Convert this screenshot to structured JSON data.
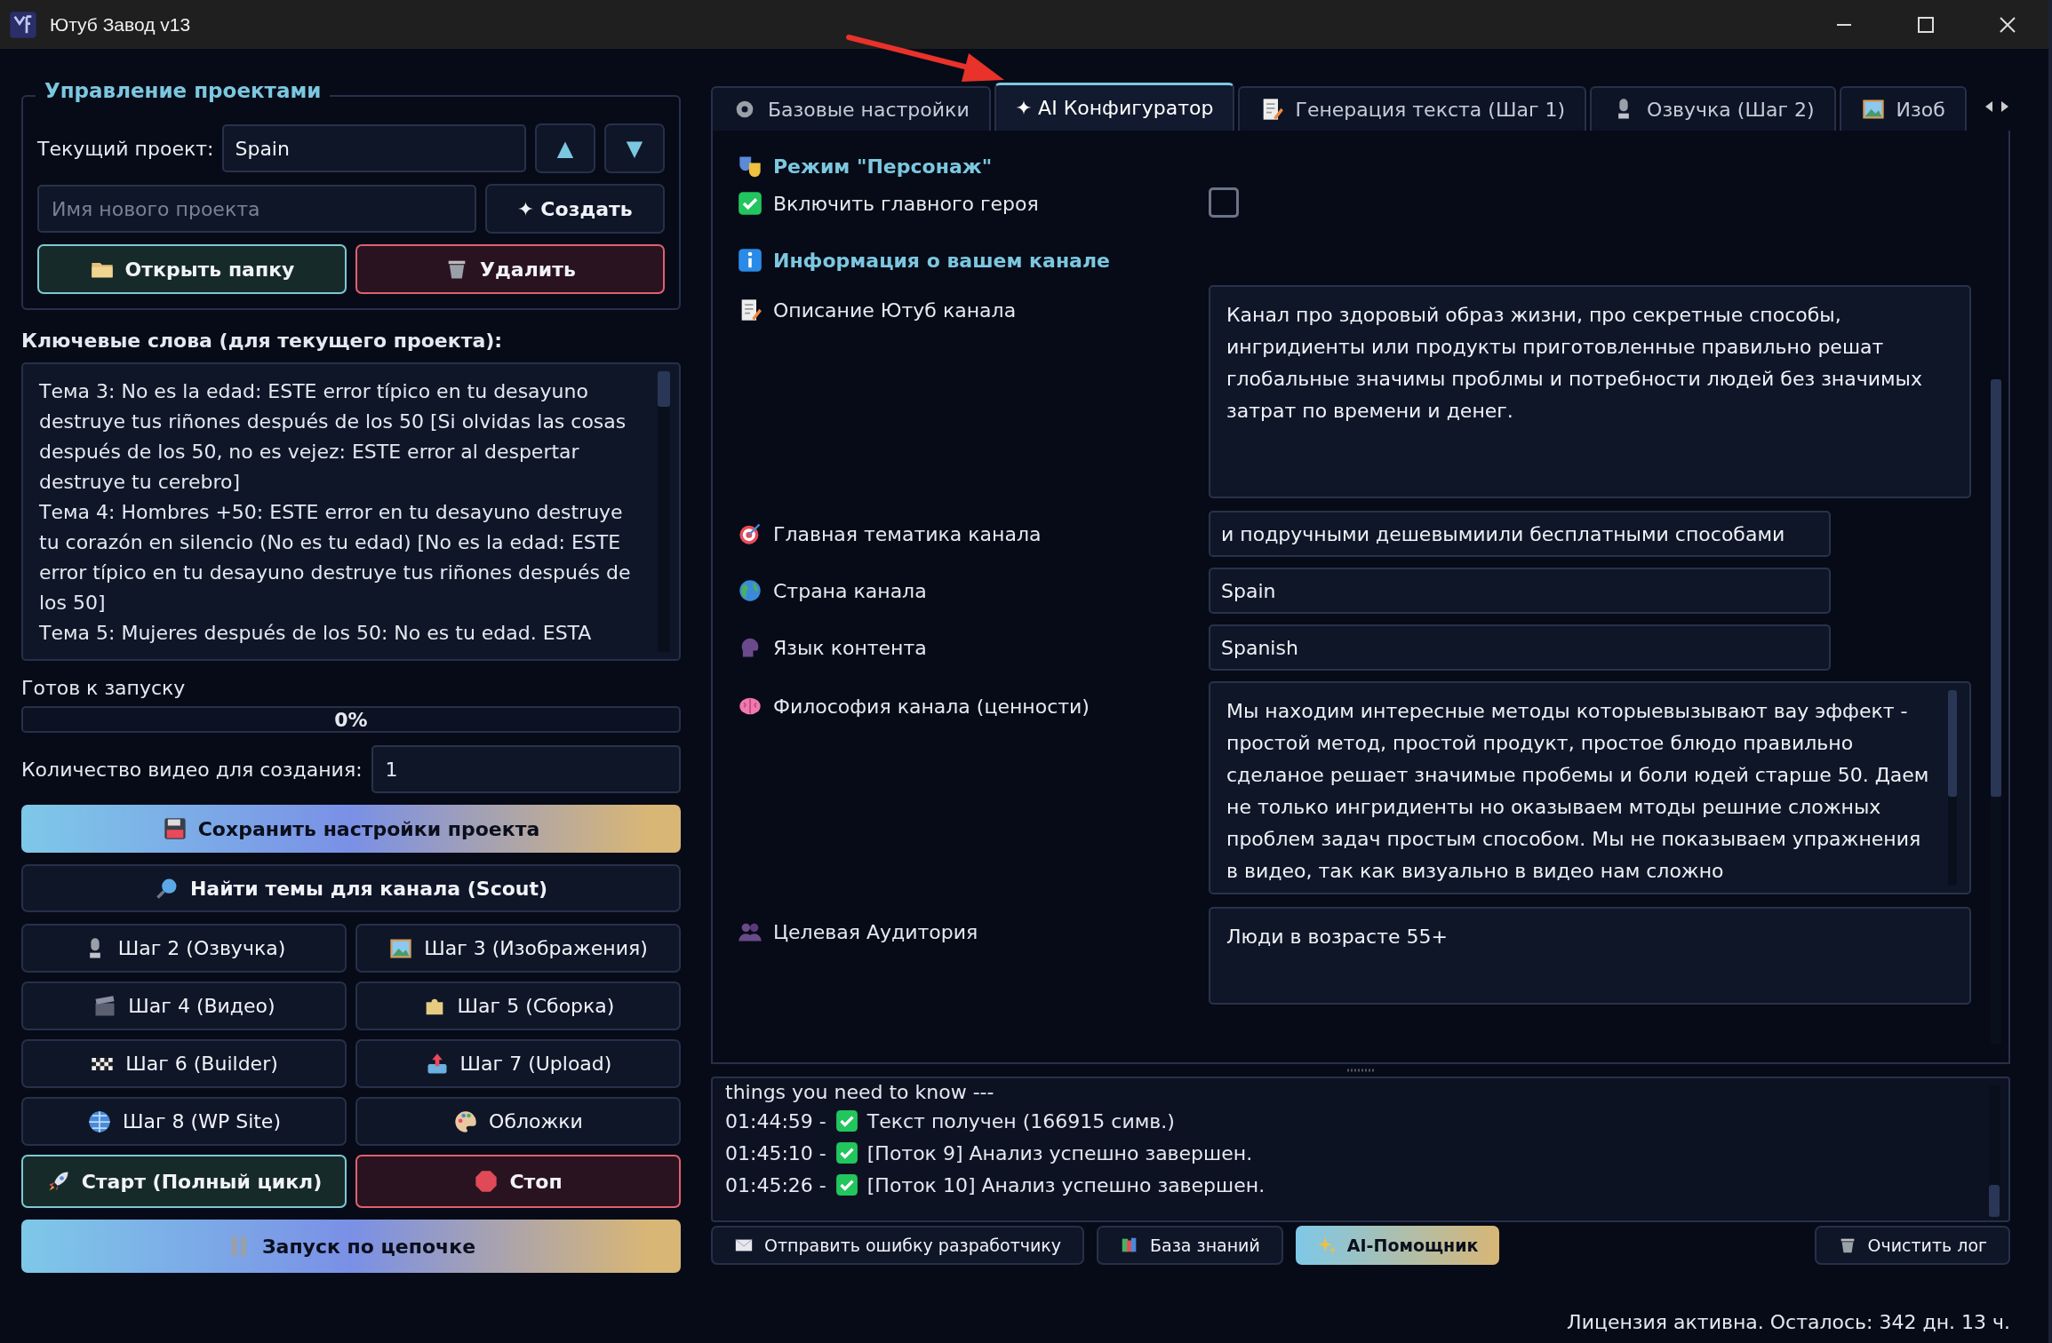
{
  "window": {
    "title": "Ютуб Завод v13"
  },
  "project_panel": {
    "title": "Управление проектами",
    "current_label": "Текущий проект:",
    "current_value": "Spain",
    "move_up": "▲",
    "move_down": "▼",
    "new_name_placeholder": "Имя нового проекта",
    "create": "✦ Создать",
    "open_folder": "Открыть папку",
    "delete": "Удалить"
  },
  "keywords": {
    "label": "Ключевые слова (для текущего проекта):",
    "paragraphs": [
      "Тема 3: No es la edad: ESTE error típico en tu desayuno destruye tus riñones después de los 50 [Si olvidas las cosas después de los 50, no es vejez: ESTE error al despertar destruye tu cerebro]",
      "Тема 4: Hombres +50: ESTE error en tu desayuno destruye tu corazón en silencio (No es tu edad) [No es la edad: ESTE error típico en tu desayuno destruye tus riñones después de los 50]",
      "Тема 5: Mujeres después de los 50: No es tu edad. ESTA"
    ]
  },
  "status": {
    "text": "Готов к запуску",
    "progress_text": "0%",
    "level": 0
  },
  "video_count": {
    "label": "Количество видео для создания:",
    "value": "1"
  },
  "actions": [
    {
      "label": "Сохранить настройки проекта",
      "kind": "gradient"
    },
    {
      "label": "Найти темы для канала (Scout)",
      "kind": "plain"
    }
  ],
  "steps": [
    {
      "label": "Шаг 2 (Озвучка)",
      "kind": "plain"
    },
    {
      "label": "Шаг 3 (Изображения)",
      "kind": "plain"
    },
    {
      "label": "Шаг 4 (Видео)",
      "kind": "plain"
    },
    {
      "label": "Шаг 5 (Сборка)",
      "kind": "plain"
    },
    {
      "label": "Шаг 6 (Builder)",
      "kind": "plain"
    },
    {
      "label": "Шаг 7 (Upload)",
      "kind": "plain"
    },
    {
      "label": "Шаг 8 (WP Site)",
      "kind": "plain"
    },
    {
      "label": "Обложки",
      "kind": "plain"
    },
    {
      "label": "Старт (Полный цикл)",
      "kind": "start"
    },
    {
      "label": "Стоп",
      "kind": "stop"
    }
  ],
  "chain_button": {
    "label": "Запуск по цепочке",
    "kind": "gradient"
  },
  "tabs": [
    {
      "label": "Базовые настройки",
      "selected": false
    },
    {
      "label": "✦ AI Конфигуратор",
      "selected": true
    },
    {
      "label": "Генерация текста (Шаг 1)",
      "selected": false
    },
    {
      "label": "Озвучка (Шаг 2)",
      "selected": false
    },
    {
      "label": "Изоб",
      "selected": false
    }
  ],
  "sections": [
    {
      "title": "Режим \"Персонаж\"",
      "rows": [
        {
          "kind": "checkbox",
          "label": "Включить главного героя",
          "checked": false
        }
      ]
    },
    {
      "title": "Информация о вашем канале",
      "rows": [
        {
          "kind": "textarea",
          "label": "Описание Ютуб канала",
          "value": "Канал про здоровый образ жизни, про секретные способы, ингридиенты или продукты приготовленные правильно решат глобальные значимы проблмы и потребности людей без значимых затрат по времени и денег."
        },
        {
          "kind": "input",
          "label": "Главная тематика канала",
          "value": "и подручными дешевымиили бесплатными способами"
        },
        {
          "kind": "input",
          "label": "Страна канала",
          "value": "Spain"
        },
        {
          "kind": "input",
          "label": "Язык контента",
          "value": "Spanish"
        },
        {
          "kind": "textarea",
          "label": "Философия канала (ценности)",
          "value": "Мы находим интересные методы которыевызывают вау эффект - простой метод, простой продукт, простое блюдо правильно сделаное решает значимые пробемы и боли юдей старше 50. Даем не только ингридиенты но оказываем мтоды решние сложных проблем задач простым способом. Мы не показываем упражнения в видео, так как визуально в видео нам сложно"
        },
        {
          "kind": "textarea",
          "label": "Целевая Аудитория",
          "value": "Люди в возрасте 55+"
        }
      ]
    }
  ],
  "log": {
    "header": "things you need to know ---",
    "lines": [
      {
        "time": "01:44:59 -",
        "text": "Текст получен (166915 симв.)"
      },
      {
        "time": "01:45:10 -",
        "text": "[Поток 9] Анализ успешно завершен."
      },
      {
        "time": "01:45:26 -",
        "text": "[Поток 10] Анализ успешно завершен."
      }
    ]
  },
  "log_buttons": [
    {
      "label": "Отправить ошибку разработчику",
      "kind": "plain"
    },
    {
      "label": "База знаний",
      "kind": "plain"
    },
    {
      "label": "AI-Помощник",
      "kind": "accent"
    },
    {
      "label": "Очистить лог",
      "kind": "plain"
    }
  ],
  "status_bar": {
    "text": "Лицензия активна. Осталось: 342 дн. 13 ч."
  }
}
